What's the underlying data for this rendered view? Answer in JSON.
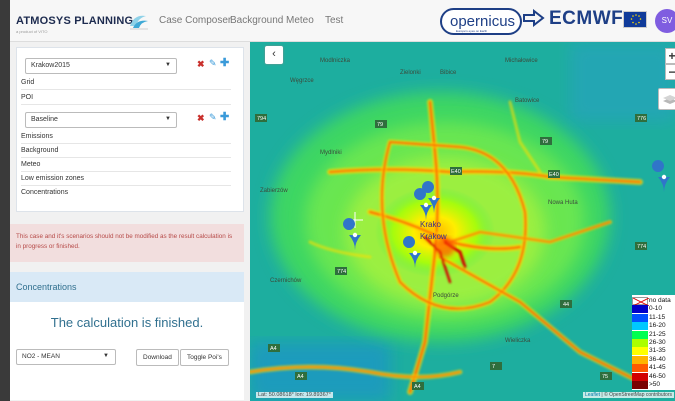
{
  "app": {
    "logo_text": "ATMOSYS PLANNING",
    "logo_subtext": "a product of VITO"
  },
  "nav": {
    "items": [
      "Case Composer",
      "Background",
      "Meteo",
      "Test"
    ]
  },
  "partners": {
    "copernicus": "opernicus",
    "copernicus_sub": "Europe's eyes on Earth",
    "ecmwf": "ECMWF",
    "user_initials": "SV"
  },
  "case_panel": {
    "case_select": "Krakow2015",
    "case_rows": [
      "Grid",
      "POI"
    ],
    "scenario_select": "Baseline",
    "scenario_rows": [
      "Emissions",
      "Background",
      "Meteo",
      "Low emission zones",
      "Concentrations"
    ]
  },
  "warning": {
    "text": "This case and it's scenarios should not be modified as the result calculation is in progress or finished."
  },
  "concentrations": {
    "header": "Concentrations",
    "status": "The calculation is finished.",
    "pollutant_select": "NO2 - MEAN",
    "download_label": "Download",
    "toggle_pois_label": "Toggle Poi's"
  },
  "map": {
    "collapse": "‹",
    "zoom_in": "+",
    "zoom_out": "−",
    "coords": "Lat: 50.08618° lon: 19.89367°",
    "attribution_leaflet": "Leaflet",
    "attribution_osm": "© OpenStreetMap contributors",
    "place_labels": [
      {
        "text": "Krako",
        "kind": "city"
      },
      {
        "text": "Krakow",
        "kind": "city"
      },
      {
        "text": "Nowa Huta",
        "kind": "town"
      },
      {
        "text": "Mydlniki",
        "kind": "town"
      },
      {
        "text": "Zielonki",
        "kind": "town"
      },
      {
        "text": "Bibice",
        "kind": "town"
      },
      {
        "text": "Batowice",
        "kind": "town"
      },
      {
        "text": "Michałowice",
        "kind": "town"
      },
      {
        "text": "Podgórze",
        "kind": "town"
      },
      {
        "text": "Wieliczka",
        "kind": "town"
      },
      {
        "text": "Modlniczka",
        "kind": "town"
      },
      {
        "text": "Węgrzce",
        "kind": "town"
      },
      {
        "text": "Czernichów",
        "kind": "town"
      },
      {
        "text": "Zabierzów",
        "kind": "town"
      }
    ],
    "road_badges": [
      "794",
      "79",
      "776",
      "E40",
      "E40",
      "774",
      "774",
      "44",
      "A4",
      "A4",
      "A4",
      "7",
      "75",
      "79"
    ],
    "legend": [
      {
        "label": "no data",
        "color": "#ffffff"
      },
      {
        "label": "0-10",
        "color": "#0000c8"
      },
      {
        "label": "11-15",
        "color": "#0050ff"
      },
      {
        "label": "16-20",
        "color": "#00c8ff"
      },
      {
        "label": "21-25",
        "color": "#00ff50"
      },
      {
        "label": "26-30",
        "color": "#aaff00"
      },
      {
        "label": "31-35",
        "color": "#ffff00"
      },
      {
        "label": "36-40",
        "color": "#ffb400"
      },
      {
        "label": "41-45",
        "color": "#ff5a00"
      },
      {
        "label": "46-50",
        "color": "#d20000"
      },
      {
        "label": ">50",
        "color": "#7a0000"
      }
    ]
  }
}
